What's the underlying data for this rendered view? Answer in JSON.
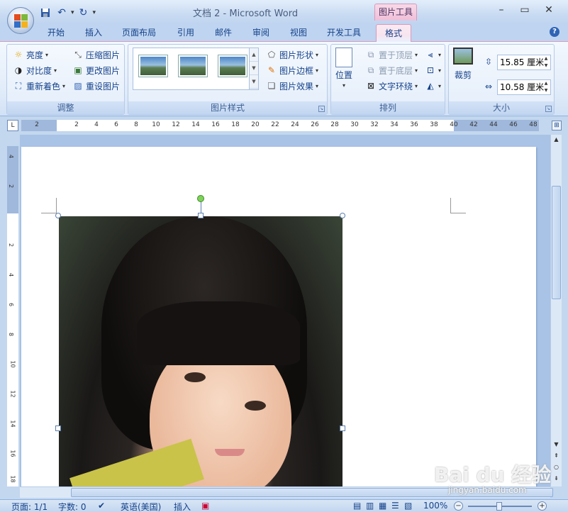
{
  "titlebar": {
    "title": "文档 2 - Microsoft Word",
    "context_tab": "图片工具",
    "minimize": "–",
    "maximize": "▭",
    "close": "✕"
  },
  "tabs": [
    "开始",
    "插入",
    "页面布局",
    "引用",
    "邮件",
    "审阅",
    "视图",
    "开发工具",
    "格式"
  ],
  "active_tab": "格式",
  "ribbon": {
    "adjust": {
      "label": "调整",
      "brightness": "亮度",
      "contrast": "对比度",
      "recolor": "重新着色",
      "compress": "压缩图片",
      "change": "更改图片",
      "reset": "重设图片"
    },
    "styles": {
      "label": "图片样式",
      "shape": "图片形状",
      "border": "图片边框",
      "effects": "图片效果"
    },
    "arrange": {
      "label": "排列",
      "position": "位置",
      "bring_front": "置于顶层",
      "send_back": "置于底层",
      "text_wrap": "文字环绕"
    },
    "size": {
      "label": "大小",
      "crop": "裁剪",
      "height": "15.85 厘米",
      "width": "10.58 厘米"
    }
  },
  "ruler": {
    "ticks": [
      "2",
      "2",
      "4",
      "6",
      "8",
      "10",
      "12",
      "14",
      "16",
      "18",
      "20",
      "22",
      "24",
      "26",
      "28",
      "30",
      "32",
      "34",
      "36",
      "38",
      "40",
      "42",
      "44",
      "46",
      "48"
    ],
    "vticks": [
      "4",
      "2",
      "2",
      "4",
      "6",
      "8",
      "10",
      "12",
      "14",
      "16",
      "18"
    ]
  },
  "statusbar": {
    "page": "页面: 1/1",
    "words": "字数: 0",
    "language": "英语(美国)",
    "mode": "插入",
    "zoom": "100%"
  },
  "watermark": {
    "logo": "Bai du 经验",
    "url": "jingyan.baidu.com"
  }
}
